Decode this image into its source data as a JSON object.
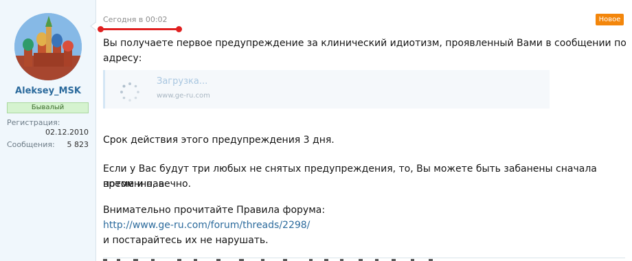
{
  "user": {
    "username": "Aleksey_MSK",
    "rank": "Бывалый",
    "registration_label": "Регистрация:",
    "registration_date": "02.12.2010",
    "messages_label": "Сообщения:",
    "messages_count": "5 823"
  },
  "post": {
    "date": "Сегодня в 00:02",
    "new_badge": "Новое",
    "line1": "Вы получаете первое предупреждение за клинический идиотизм, проявленный Вами в сообщении по",
    "line2": "адресу:",
    "embed": {
      "title": "Загрузка...",
      "url": "www.ge-ru.com"
    },
    "expiry": "Срок действия этого предупреждения 3 дня.",
    "warning_line1": "Если у Вас будут три любых не снятых предупреждения, то, Вы можете быть забанены сначала временно, а",
    "warning_line2": "потом и навечно.",
    "rules_intro": "Внимательно прочитайте Правила форума:",
    "rules_link": "http://www.ge-ru.com/forum/threads/2298/",
    "closing": "и постарайтесь их не нарушать."
  },
  "colors": {
    "annotation": "#e02020",
    "new_badge": "#f3860b",
    "link": "#2b6a9c"
  }
}
